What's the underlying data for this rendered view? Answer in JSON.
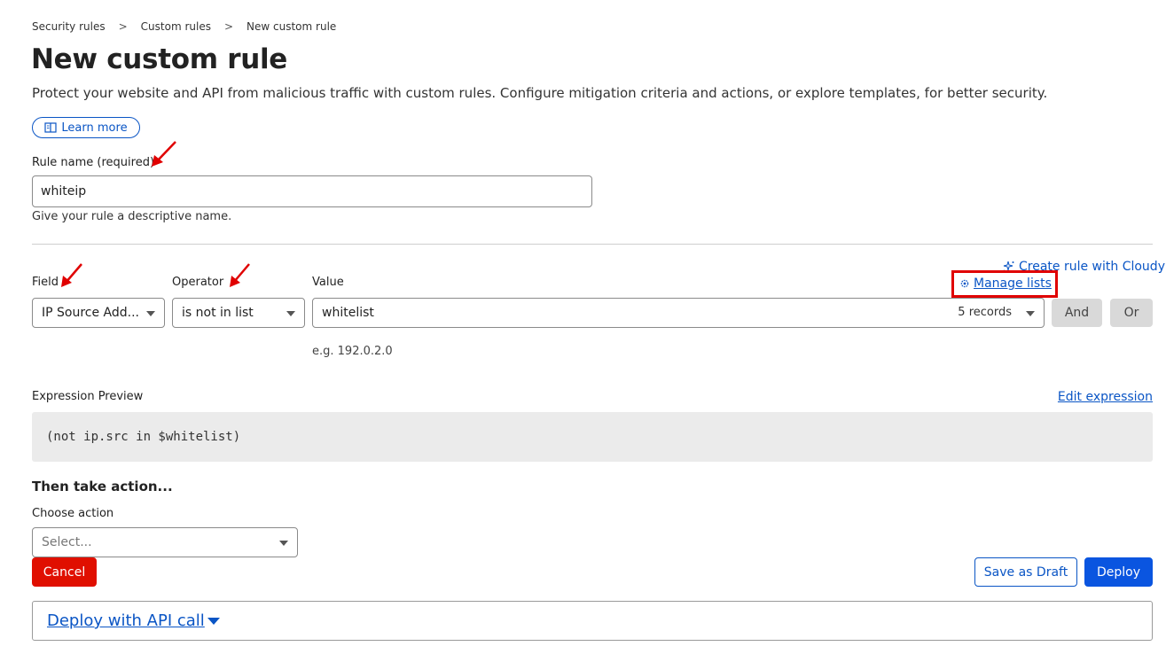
{
  "breadcrumb": {
    "items": [
      "Security rules",
      "Custom rules",
      "New custom rule"
    ],
    "separator": ">"
  },
  "page": {
    "title": "New custom rule",
    "subtitle": "Protect your website and API from malicious traffic with custom rules. Configure mitigation criteria and actions, or explore templates, for better security.",
    "learn_more_label": "Learn more"
  },
  "rule_name": {
    "label": "Rule name (required)",
    "value": "whiteip",
    "hint": "Give your rule a descriptive name."
  },
  "expression_builder": {
    "create_with_cloudy_label": "Create rule with Cloudy",
    "manage_lists_label": "Manage lists",
    "field_label": "Field",
    "field_value": "IP Source Add...",
    "operator_label": "Operator",
    "operator_value": "is not in list",
    "value_label": "Value",
    "value_value": "whitelist",
    "value_records": "5 records",
    "value_example": "e.g. 192.0.2.0",
    "and_label": "And",
    "or_label": "Or"
  },
  "expression_preview": {
    "label": "Expression Preview",
    "edit_label": "Edit expression",
    "code": "(not ip.src in $whitelist)"
  },
  "action": {
    "section_title": "Then take action...",
    "choose_label": "Choose action",
    "placeholder": "Select..."
  },
  "footer": {
    "cancel_label": "Cancel",
    "save_draft_label": "Save as Draft",
    "deploy_label": "Deploy",
    "api_call_label": "Deploy with API call"
  },
  "colors": {
    "link_blue": "#0a55c5",
    "primary_blue": "#0a55e0",
    "danger_red": "#e00f00",
    "annotation_red": "#e00000"
  },
  "icons": [
    "book-icon",
    "sparkle-icon",
    "gear-icon",
    "chevron-right-icon",
    "caret-down-icon",
    "annotation-arrow-icon"
  ]
}
